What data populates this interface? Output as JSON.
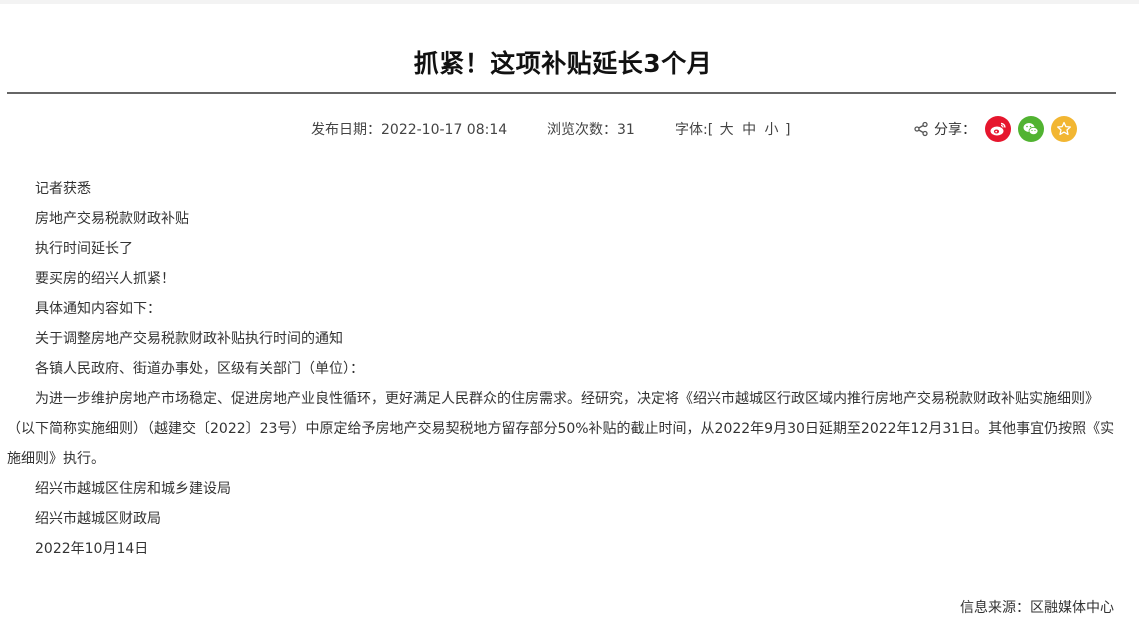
{
  "article": {
    "title": "抓紧！这项补贴延长3个月",
    "publish_date": "发布日期：2022-10-17 08:14",
    "views": "浏览次数：31",
    "font_label": "字体:[",
    "font_large": "大",
    "font_medium": "中",
    "font_small": "小",
    "font_close": "]",
    "share_label": "分享：",
    "source": "信息来源：区融媒体中心"
  },
  "share_buttons": [
    {
      "name": "weibo",
      "icon": "weibo-icon",
      "color": "#e6162d"
    },
    {
      "name": "wechat",
      "icon": "wechat-icon",
      "color": "#51b331"
    },
    {
      "name": "favorite",
      "icon": "star-icon",
      "color": "#f2b632"
    }
  ],
  "paragraphs": [
    "记者获悉",
    "房地产交易税款财政补贴",
    "执行时间延长了",
    "要买房的绍兴人抓紧！",
    "具体通知内容如下：",
    "关于调整房地产交易税款财政补贴执行时间的通知",
    "各镇人民政府、街道办事处，区级有关部门（单位）：",
    "为进一步维护房地产市场稳定、促进房地产业良性循环，更好满足人民群众的住房需求。经研究，决定将《绍兴市越城区行政区域内推行房地产交易税款财政补贴实施细则》（以下简称实施细则）（越建交〔2022〕23号）中原定给予房地产交易契税地方留存部分50%补贴的截止时间，从2022年9月30日延期至2022年12月31日。其他事宜仍按照《实施细则》执行。",
    "绍兴市越城区住房和城乡建设局",
    "绍兴市越城区财政局",
    "2022年10月14日"
  ]
}
